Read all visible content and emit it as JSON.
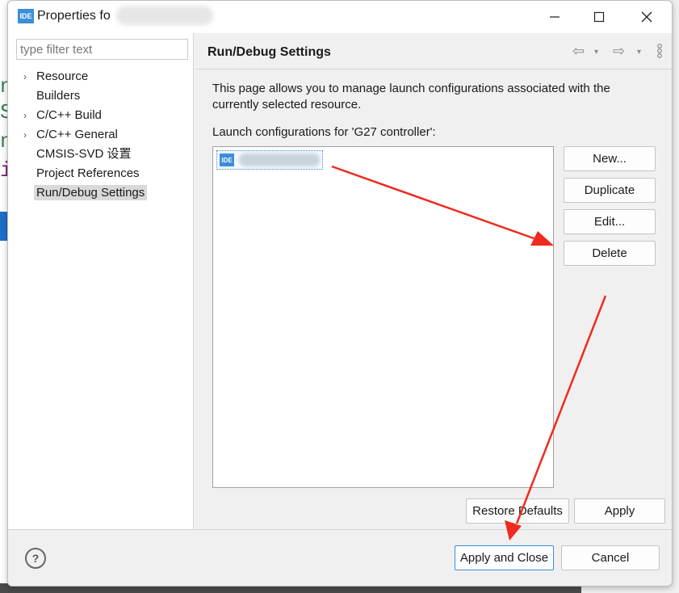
{
  "window": {
    "app_icon": "IDE",
    "title": "Properties fo",
    "minimize_icon": "minimize-icon",
    "maximize_icon": "maximize-icon",
    "close_icon": "close-icon"
  },
  "sidebar": {
    "filter_placeholder": "type filter text",
    "items": [
      {
        "label": "Resource",
        "expandable": true
      },
      {
        "label": "Builders",
        "expandable": false
      },
      {
        "label": "C/C++ Build",
        "expandable": true
      },
      {
        "label": "C/C++ General",
        "expandable": true
      },
      {
        "label": "CMSIS-SVD 设置",
        "expandable": false
      },
      {
        "label": "Project References",
        "expandable": false
      },
      {
        "label": "Run/Debug Settings",
        "expandable": false,
        "selected": true
      }
    ]
  },
  "page": {
    "title": "Run/Debug Settings",
    "description": "This page allows you to manage launch configurations associated with the currently selected resource.",
    "list_label": "Launch configurations for 'G27 controller':",
    "list_item_icon": "IDE",
    "buttons": {
      "new": "New...",
      "duplicate": "Duplicate",
      "edit": "Edit...",
      "delete": "Delete"
    },
    "restore_defaults": "Restore Defaults",
    "apply": "Apply"
  },
  "footer": {
    "help": "?",
    "apply_and_close": "Apply and Close",
    "cancel": "Cancel"
  },
  "colors": {
    "accent": "#3b8fd9",
    "annotation_arrow": "#ee2b1e"
  }
}
